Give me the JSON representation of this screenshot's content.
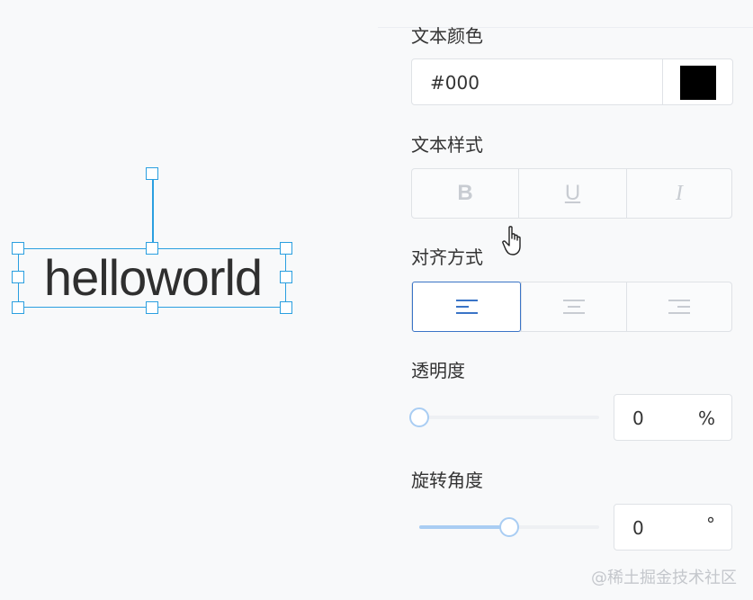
{
  "canvas": {
    "text_object": {
      "text": "helloworld",
      "color": "#2f2f2f"
    }
  },
  "panel": {
    "text_color": {
      "label": "文本颜色",
      "value": "#000",
      "swatch_color": "#000000"
    },
    "text_style": {
      "label": "文本样式",
      "buttons": [
        {
          "name": "bold",
          "glyph": "B"
        },
        {
          "name": "underline",
          "glyph": "U"
        },
        {
          "name": "italic",
          "glyph": "I"
        }
      ]
    },
    "alignment": {
      "label": "对齐方式",
      "options": [
        "align-left-icon",
        "align-center-icon",
        "align-right-icon"
      ],
      "selected": "left"
    },
    "opacity": {
      "label": "透明度",
      "value": "0",
      "unit": "%",
      "slider_fraction": 0
    },
    "rotation": {
      "label": "旋转角度",
      "value": "0",
      "unit": "°",
      "slider_fraction": 0.5
    }
  },
  "watermark": "@稀土掘金技术社区",
  "colors": {
    "accent": "#2a9fe0",
    "selected_border": "#3a74c7",
    "slider_fill": "#a9cdf3"
  }
}
